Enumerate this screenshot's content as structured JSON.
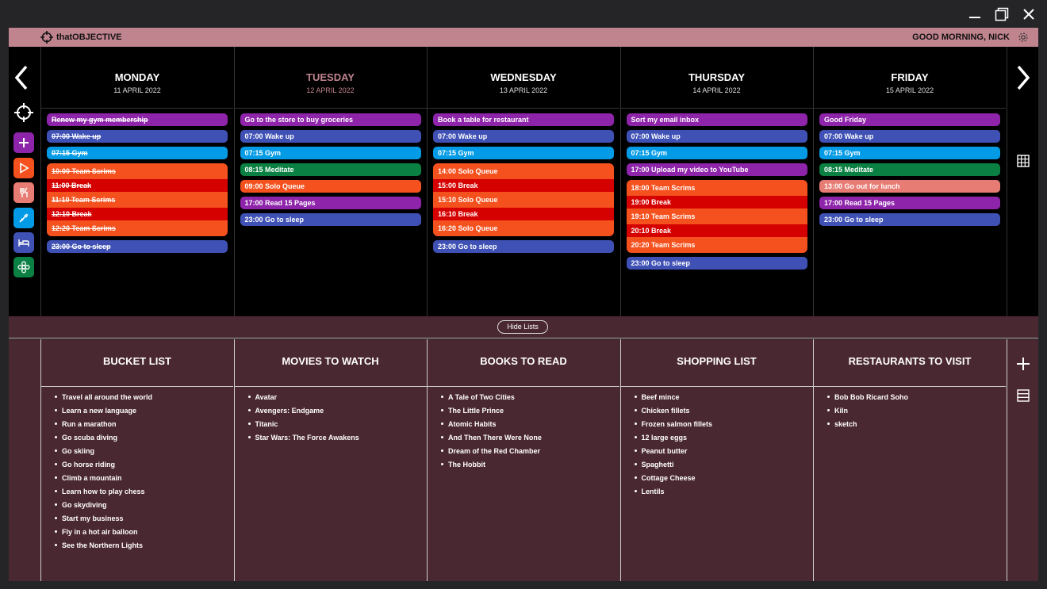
{
  "header": {
    "app_name": "thatOBJECTIVE",
    "greeting": "GOOD MORNING, NICK"
  },
  "window": {
    "minimize": "—",
    "maximize": "❐",
    "close": "✕"
  },
  "nav": {
    "prev": "‹",
    "next": "›"
  },
  "days": [
    {
      "name": "MONDAY",
      "date": "11 APRIL 2022",
      "today": false,
      "rows": [
        {
          "t": "Renew my gym membership",
          "c": "purple",
          "done": true
        },
        {
          "t": "07:00 Wake up",
          "c": "blue",
          "done": true
        },
        {
          "t": "07:15 Gym",
          "c": "sky",
          "done": true
        },
        {
          "group": [
            {
              "t": "10:00 Team Scrims",
              "done": true
            },
            {
              "t": "11:00 Break",
              "b": 1,
              "done": true
            },
            {
              "t": "11:10 Team Scrims",
              "done": true
            },
            {
              "t": "12:10 Break",
              "b": 1,
              "done": true
            },
            {
              "t": "12:20 Team Scrims",
              "done": true
            }
          ]
        },
        {
          "t": "23:00 Go to sleep",
          "c": "blue",
          "done": true
        }
      ]
    },
    {
      "name": "TUESDAY",
      "date": "12 APRIL 2022",
      "today": true,
      "rows": [
        {
          "t": "Go to the store to buy groceries",
          "c": "purple"
        },
        {
          "t": "07:00 Wake up",
          "c": "blue"
        },
        {
          "t": "07:15 Gym",
          "c": "sky"
        },
        {
          "t": "08:15 Meditate",
          "c": "green"
        },
        {
          "t": "09:00 Solo Queue",
          "c": "tomato"
        },
        {
          "t": "17:00 Read 15 Pages",
          "c": "purple"
        },
        {
          "t": "23:00 Go to sleep",
          "c": "blue"
        }
      ]
    },
    {
      "name": "WEDNESDAY",
      "date": "13 APRIL 2022",
      "today": false,
      "rows": [
        {
          "t": "Book a table for restaurant",
          "c": "purple"
        },
        {
          "t": "07:00 Wake up",
          "c": "blue"
        },
        {
          "t": "07:15 Gym",
          "c": "sky"
        },
        {
          "group": [
            {
              "t": "14:00 Solo Queue"
            },
            {
              "t": "15:00 Break",
              "b": 1
            },
            {
              "t": "15:10 Solo Queue"
            },
            {
              "t": "16:10 Break",
              "b": 1
            },
            {
              "t": "16:20 Solo Queue"
            }
          ]
        },
        {
          "t": "23:00 Go to sleep",
          "c": "blue"
        }
      ]
    },
    {
      "name": "THURSDAY",
      "date": "14 APRIL 2022",
      "today": false,
      "rows": [
        {
          "t": "Sort my email inbox",
          "c": "purple"
        },
        {
          "t": "07:00 Wake up",
          "c": "blue"
        },
        {
          "t": "07:15 Gym",
          "c": "sky"
        },
        {
          "t": "17:00 Upload my video to YouTube",
          "c": "purple"
        },
        {
          "group": [
            {
              "t": "18:00 Team Scrims"
            },
            {
              "t": "19:00 Break",
              "b": 1
            },
            {
              "t": "19:10 Team Scrims"
            },
            {
              "t": "20:10 Break",
              "b": 1
            },
            {
              "t": "20:20 Team Scrims"
            }
          ]
        },
        {
          "t": "23:00 Go to sleep",
          "c": "blue"
        }
      ]
    },
    {
      "name": "FRIDAY",
      "date": "15 APRIL 2022",
      "today": false,
      "rows": [
        {
          "t": "Good Friday",
          "c": "purple"
        },
        {
          "t": "07:00 Wake up",
          "c": "blue"
        },
        {
          "t": "07:15 Gym",
          "c": "sky"
        },
        {
          "t": "08:15 Meditate",
          "c": "green"
        },
        {
          "t": "13:00 Go out for lunch",
          "c": "flam"
        },
        {
          "t": "17:00 Read 15 Pages",
          "c": "purple"
        },
        {
          "t": "23:00 Go to sleep",
          "c": "blue"
        }
      ]
    }
  ],
  "hide_lists": "Hide Lists",
  "lists": [
    {
      "title": "BUCKET LIST",
      "items": [
        "Travel all around the world",
        "Learn a new language",
        "Run a marathon",
        "Go scuba diving",
        "Go skiing",
        "Go horse riding",
        "Climb a mountain",
        "Learn how to play chess",
        "Go skydiving",
        "Start my business",
        "Fly in a hot air balloon",
        "See the Northern Lights"
      ]
    },
    {
      "title": "MOVIES TO WATCH",
      "items": [
        "Avatar",
        "Avengers: Endgame",
        "Titanic",
        "Star Wars: The Force Awakens"
      ]
    },
    {
      "title": "BOOKS TO READ",
      "items": [
        "A Tale of Two Cities",
        "The Little Prince",
        "Atomic Habits",
        "And Then There Were None",
        "Dream of the Red Chamber",
        "The Hobbit"
      ]
    },
    {
      "title": "SHOPPING LIST",
      "items": [
        "Beef mince",
        "Chicken fillets",
        "Frozen salmon fillets",
        "12 large eggs",
        "Peanut butter",
        "Spaghetti",
        "Cottage Cheese",
        "Lentils"
      ]
    },
    {
      "title": "RESTAURANTS TO VISIT",
      "items": [
        "Bob Bob Ricard Soho",
        "Kiln",
        "sketch"
      ]
    }
  ],
  "colors": {
    "appbar": "#c0848e",
    "today": "#c0848e",
    "lists_bg": "#4a2832",
    "purple": "#8e24aa",
    "blue": "#3f51b5",
    "sky": "#039be5",
    "green": "#0b8043",
    "tomato": "#f4511e",
    "break": "#d50000",
    "flamingo": "#e67c73"
  },
  "icons": [
    "crosshair-icon",
    "plus-icon",
    "play-icon",
    "fork-knife-icon",
    "syringe-icon",
    "bed-icon",
    "flower-icon",
    "grid-icon",
    "settings-icon",
    "list-icon"
  ]
}
